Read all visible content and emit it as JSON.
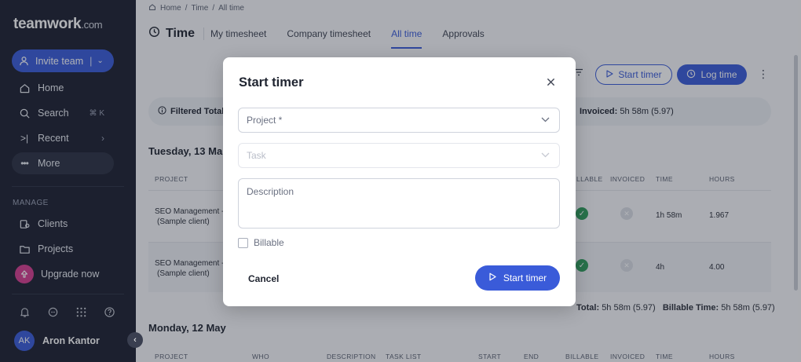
{
  "sidebar": {
    "logo": "teamwork",
    "logo_suffix": ".com",
    "invite_label": "Invite team",
    "invite_sep": "|",
    "nav": {
      "home": "Home",
      "search": "Search",
      "search_shortcut": "⌘ K",
      "recent": "Recent",
      "more": "More"
    },
    "manage_label": "MANAGE",
    "manage": {
      "clients": "Clients",
      "projects": "Projects",
      "upgrade": "Upgrade now"
    },
    "user": {
      "initials": "AK",
      "name": "Aron Kantor"
    }
  },
  "main": {
    "breadcrumb": [
      "Home",
      "/",
      "Time",
      "/",
      "All time"
    ],
    "title": "Time",
    "tabs": [
      {
        "label": "My timesheet"
      },
      {
        "label": "Company timesheet"
      },
      {
        "label": "All time",
        "active": true
      },
      {
        "label": "Approvals"
      }
    ],
    "start_timer_label": "Start timer",
    "log_time_label": "Log time",
    "filter_left": "Filtered Total",
    "filter_right_label": "Invoiced:",
    "filter_right_value": "5h 58m (5.97)",
    "day1": "Tuesday, 13 Ma",
    "day2": "Monday, 12 May",
    "headers_top": {
      "project": "PROJECT",
      "billable": "LLABLE",
      "invoiced": "INVOICED",
      "time": "TIME",
      "hours": "HOURS"
    },
    "headers_bottom": {
      "project": "PROJECT",
      "who": "WHO",
      "description": "DESCRIPTION",
      "task_list": "TASK LIST",
      "start": "START",
      "end": "END",
      "billable": "BILLABLE",
      "invoiced": "INVOICED",
      "time": "TIME",
      "hours": "HOURS"
    },
    "rows": [
      {
        "project_line1": "SEO Management -",
        "project_line2": "(Sample client)",
        "time": "1h 58m",
        "hours": "1.967"
      },
      {
        "project_line1": "SEO Management -",
        "project_line2": "(Sample client)",
        "time": "4h",
        "hours": "4.00"
      }
    ],
    "totals": {
      "total_label": "Total:",
      "total_value": "5h 58m (5.97)",
      "billable_label": "Billable Time:",
      "billable_value": "5h 58m (5.97)"
    }
  },
  "modal": {
    "title": "Start timer",
    "project_placeholder": "Project *",
    "task_placeholder": "Task",
    "description_placeholder": "Description",
    "billable_label": "Billable",
    "cancel_label": "Cancel",
    "start_label": "Start timer"
  },
  "colors": {
    "accent": "#3a5bd9",
    "sidebar_bg": "#1c2030",
    "success": "#2e9d5b",
    "upgrade": "#d63d8f"
  }
}
